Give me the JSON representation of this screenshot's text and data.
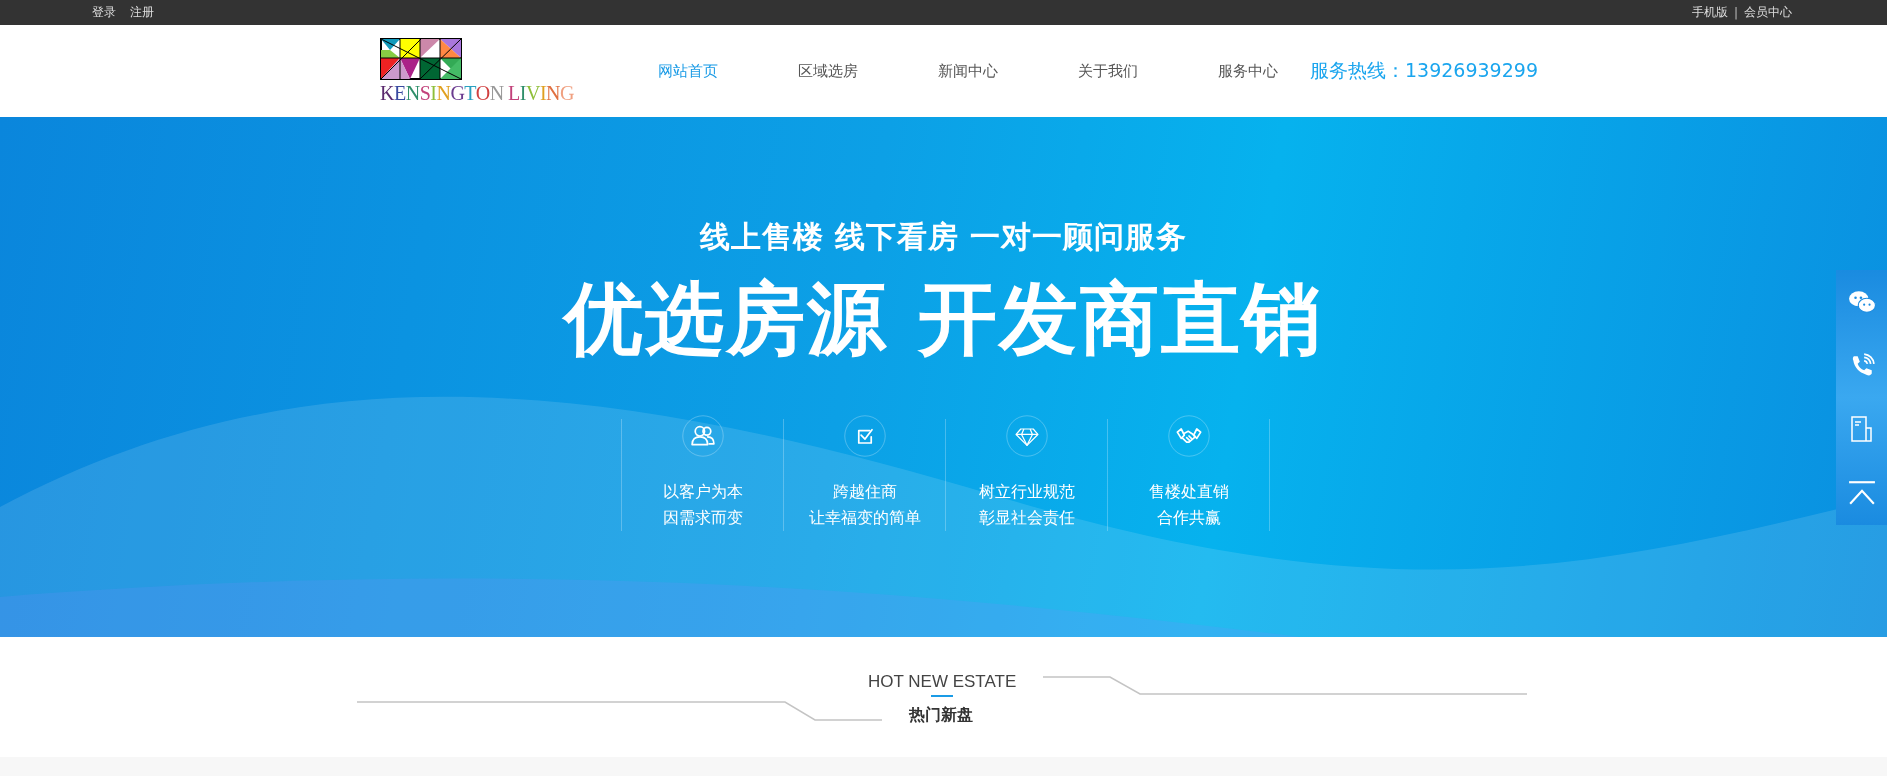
{
  "top_bar": {
    "left_links": [
      "登录",
      "注册"
    ],
    "right_links": [
      "手机版",
      "会员中心"
    ],
    "separator": "|"
  },
  "header": {
    "logo_text": "KENSINGTON LIVING",
    "nav": [
      {
        "label": "网站首页",
        "selected": true
      },
      {
        "label": "区域选房",
        "selected": false
      },
      {
        "label": "新闻中心",
        "selected": false
      },
      {
        "label": "关于我们",
        "selected": false
      },
      {
        "label": "服务中心",
        "selected": false
      }
    ],
    "hotline": "服务热线：13926939299"
  },
  "banner": {
    "subtitle": "线上售楼 线下看房 一对一顾问服务",
    "title": "优选房源 开发商直销",
    "features": [
      {
        "kind": "people",
        "lines": [
          "以客户为本",
          "因需求而变"
        ]
      },
      {
        "kind": "check",
        "lines": [
          "跨越住商",
          "让幸福变的简单"
        ]
      },
      {
        "kind": "diamond",
        "lines": [
          "树立行业规范",
          "彰显社会责任"
        ]
      },
      {
        "kind": "handshake",
        "lines": [
          "售楼处直销",
          "合作共赢"
        ]
      }
    ]
  },
  "side_bar": [
    {
      "kind": "chat"
    },
    {
      "kind": "phone"
    },
    {
      "kind": "document"
    },
    {
      "kind": "top"
    }
  ],
  "section": {
    "title_en": "HOT NEW ESTATE",
    "title_cn": "热门新盘"
  }
}
